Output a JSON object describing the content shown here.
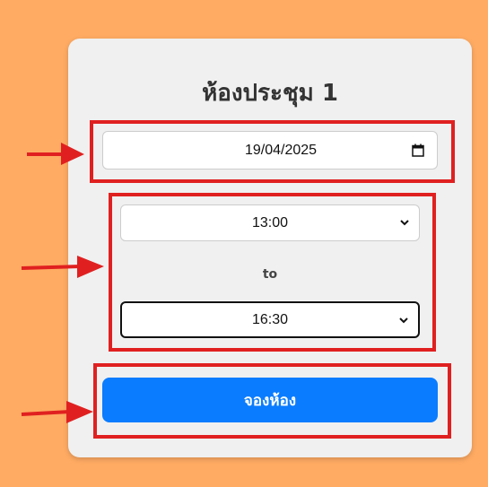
{
  "page": {
    "background_color": "#FFAB63",
    "card_color": "#F0F0F0",
    "highlight_color": "#E02020"
  },
  "booking": {
    "title": "ห้องประชุม 1",
    "date_value": "19/04/2025",
    "date_icon": "calendar-icon",
    "start_time": "13:00",
    "separator": "to",
    "end_time": "16:30",
    "submit_label": "จองห้อง",
    "submit_color": "#0A7CFF"
  }
}
